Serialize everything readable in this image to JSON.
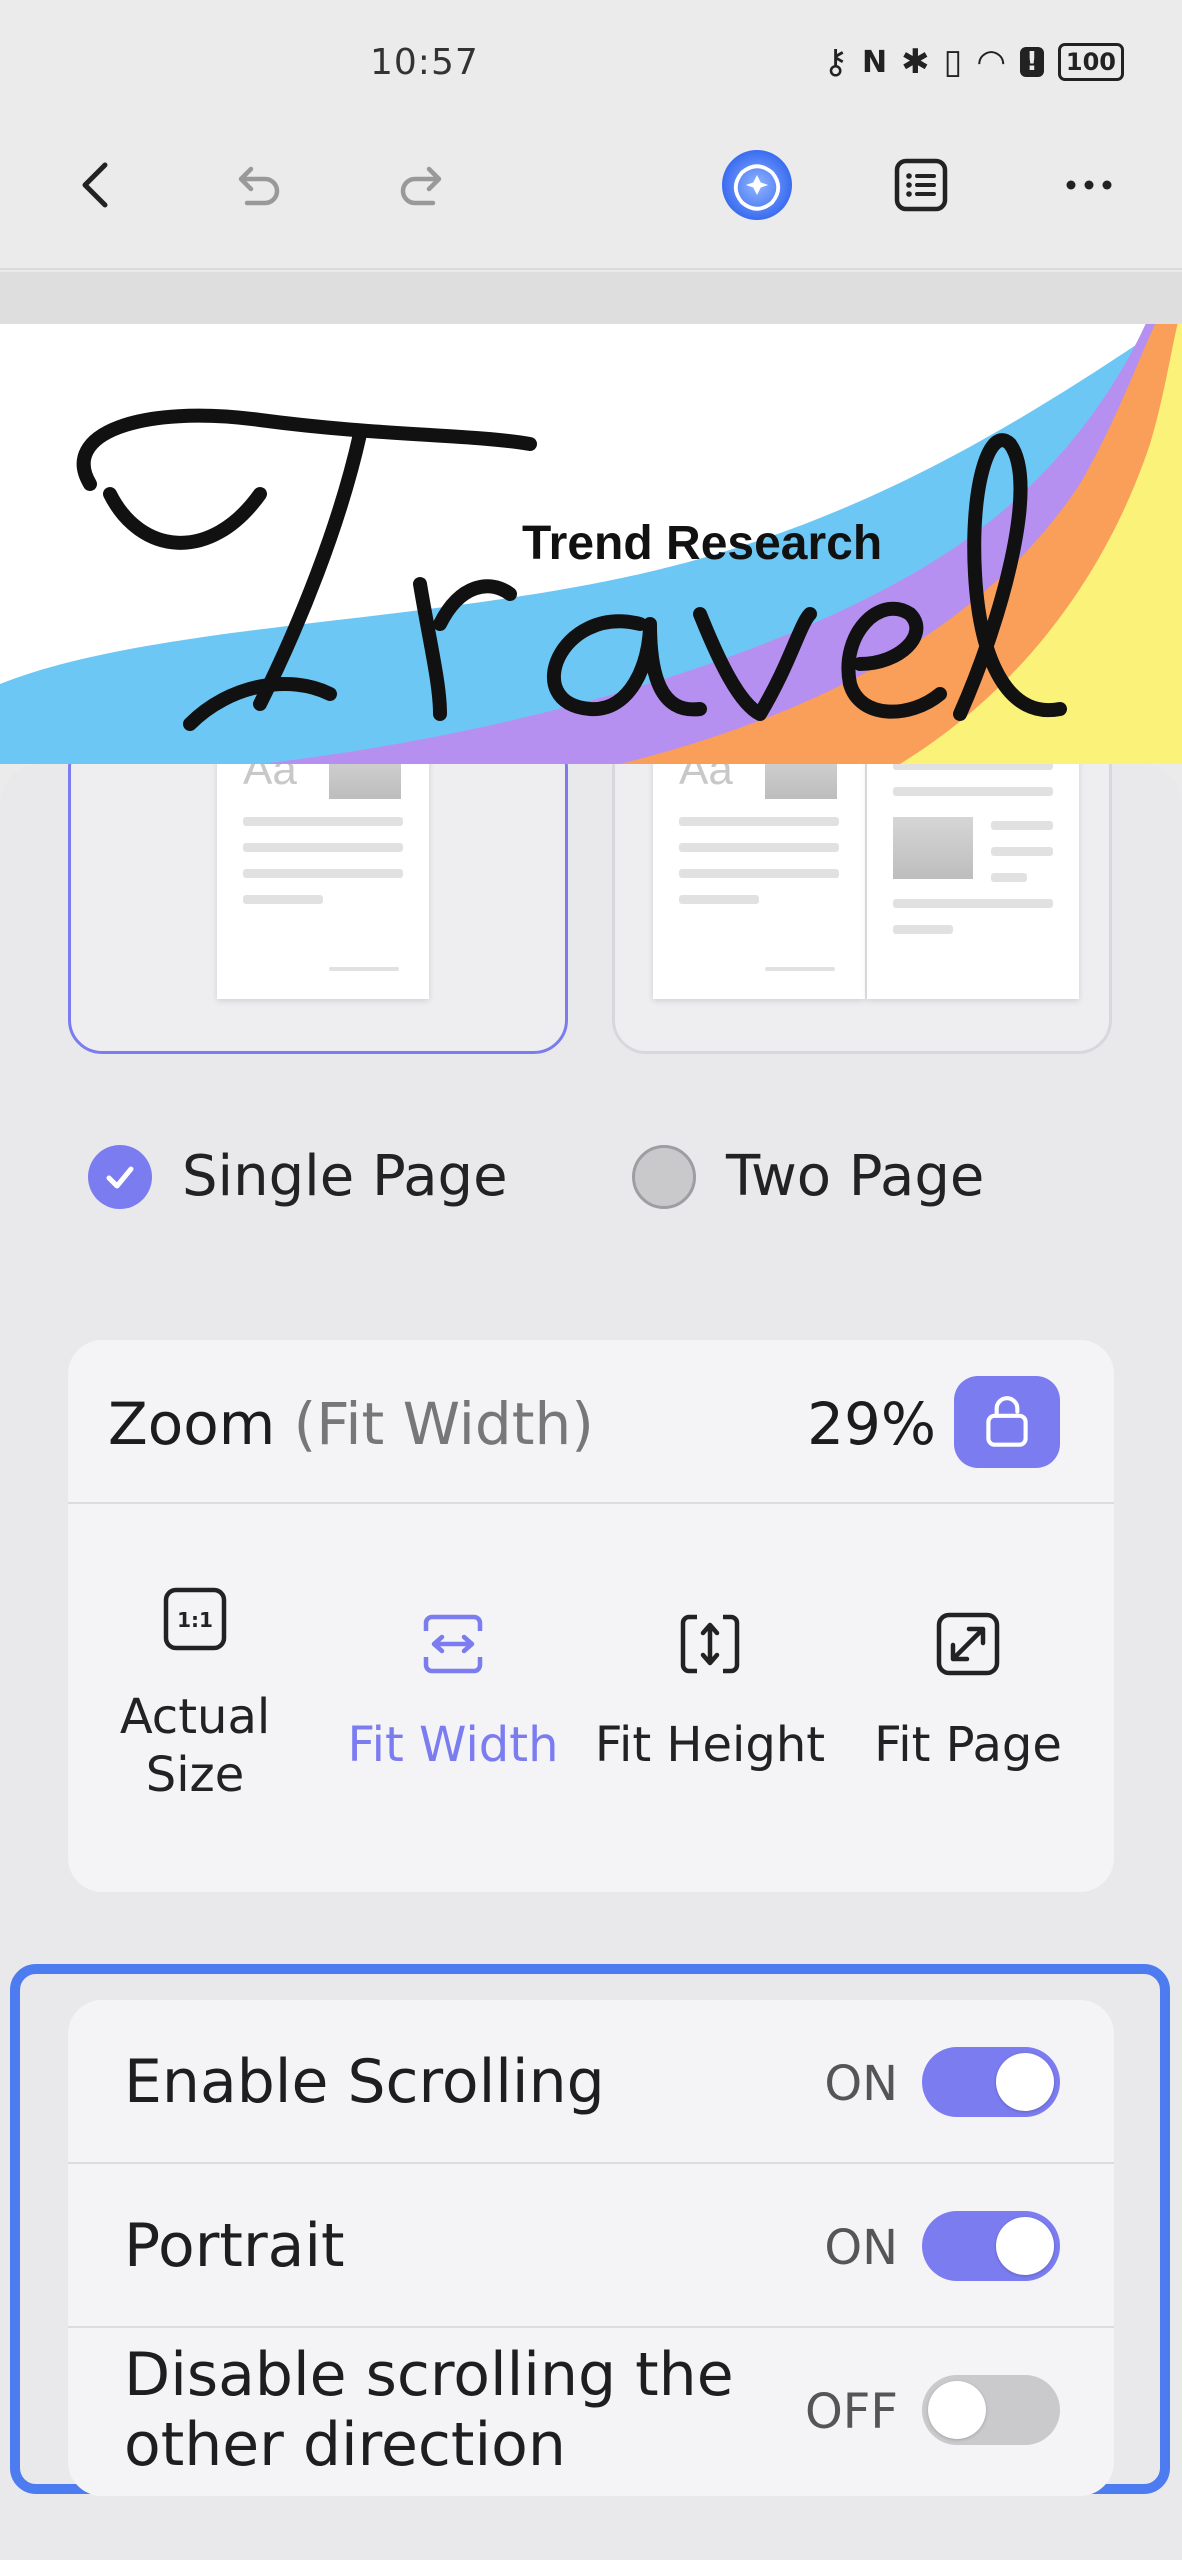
{
  "status_bar": {
    "time": "10:57",
    "battery": "100"
  },
  "document": {
    "script_title": "Travel",
    "subtitle": "Trend Research"
  },
  "page_layout": {
    "options": [
      {
        "label": "Single Page",
        "selected": true,
        "thumb_text": "Aa"
      },
      {
        "label": "Two Page",
        "selected": false,
        "thumb_text": "Aa"
      }
    ]
  },
  "zoom": {
    "title": "Zoom",
    "mode": "(Fit Width)",
    "percent": "29%",
    "options": [
      {
        "label": "Actual Size",
        "icon": "actual-size-icon",
        "glyph": "1:1"
      },
      {
        "label": "Fit Width",
        "icon": "fit-width-icon",
        "active": true
      },
      {
        "label": "Fit Height",
        "icon": "fit-height-icon"
      },
      {
        "label": "Fit Page",
        "icon": "fit-page-icon"
      }
    ]
  },
  "settings": [
    {
      "label": "Enable Scrolling",
      "state": "ON",
      "on": true
    },
    {
      "label": "Portrait",
      "state": "ON",
      "on": true
    },
    {
      "label": "Disable scrolling the other direction",
      "state": "OFF",
      "on": false
    }
  ],
  "colors": {
    "accent": "#7b7cf0",
    "highlight": "#4d7bf0"
  }
}
